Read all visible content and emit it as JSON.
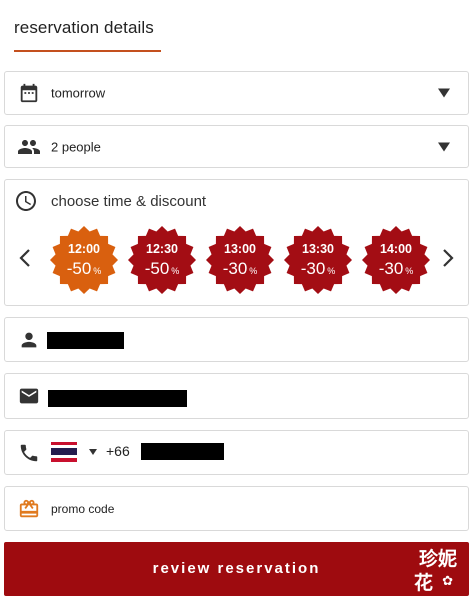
{
  "header": {
    "title": "reservation details"
  },
  "date_select": {
    "value": "tomorrow",
    "icon": "calendar-icon"
  },
  "people_select": {
    "value": "2 people",
    "icon": "people-icon"
  },
  "time_section": {
    "title": "choose time & discount",
    "icon": "clock-icon",
    "slots": [
      {
        "time": "12:00",
        "discount": "-50",
        "unit": "%",
        "color": "#d9600f",
        "selected": true
      },
      {
        "time": "12:30",
        "discount": "-50",
        "unit": "%",
        "color": "#a30d14",
        "selected": false
      },
      {
        "time": "13:00",
        "discount": "-30",
        "unit": "%",
        "color": "#a30d14",
        "selected": false
      },
      {
        "time": "13:30",
        "discount": "-30",
        "unit": "%",
        "color": "#a30d14",
        "selected": false
      },
      {
        "time": "14:00",
        "discount": "-30",
        "unit": "%",
        "color": "#a30d14",
        "selected": false
      }
    ]
  },
  "name_field": {
    "icon": "person-icon"
  },
  "email_field": {
    "icon": "mail-icon"
  },
  "phone_field": {
    "icon": "phone-icon",
    "country_code": "+66",
    "flag": "thailand-flag"
  },
  "promo": {
    "label": "promo code",
    "icon": "gift-icon"
  },
  "cta": {
    "label": "review reservation",
    "color": "#9e0b0f"
  },
  "watermark": {
    "line1": "珍妮",
    "line2": "花"
  }
}
